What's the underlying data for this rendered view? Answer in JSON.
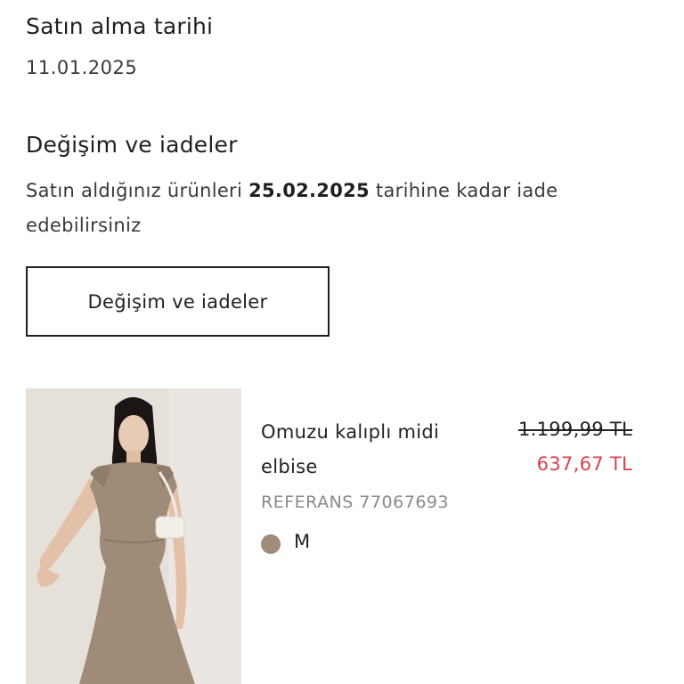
{
  "purchase": {
    "title": "Satın alma tarihi",
    "date": "11.01.2025"
  },
  "returns": {
    "title": "Değişim ve iadeler",
    "text_before": "Satın aldığınız ürünleri ",
    "deadline": "25.02.2025",
    "text_after": " tarihine kadar iade edebilirsiniz",
    "button_label": "Değişim ve iadeler"
  },
  "product": {
    "name": "Omuzu kalıplı midi elbise",
    "price_old": "1.199,99 TL",
    "price_new": "637,67 TL",
    "reference": "REFERANS 77067693",
    "color_name": "taupe",
    "color_hex": "#a08c78",
    "size": "M"
  },
  "colors": {
    "sale_price": "#d9404f",
    "text_muted": "#8a8a8a",
    "text_primary": "#1f1f1f"
  }
}
